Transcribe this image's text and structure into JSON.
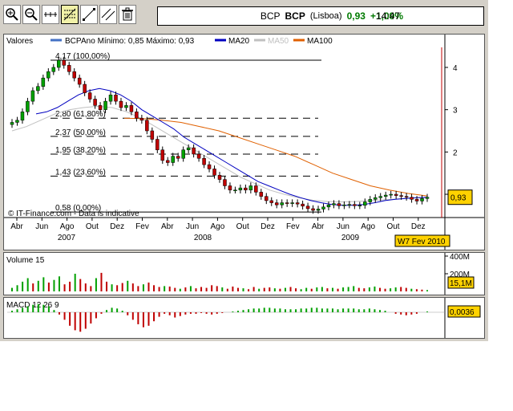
{
  "toolbar": {
    "buttons": [
      {
        "icon": "zoom-in-icon"
      },
      {
        "icon": "zoom-out-icon"
      },
      {
        "icon": "crosshair-icon"
      },
      {
        "icon": "fibonacci-icon"
      },
      {
        "icon": "trend-line-icon"
      },
      {
        "icon": "channel-icon"
      },
      {
        "icon": "trash-icon"
      }
    ]
  },
  "quote": {
    "ticker1": "BCP",
    "ticker2": "BCP",
    "exchange": "(Lisboa)",
    "price": "0,93",
    "change": "+1,09%",
    "time": "14:47"
  },
  "colors": {
    "up": "#00a000",
    "down": "#c00000",
    "ma20": "#0000c0",
    "ma50": "#c0c0c0",
    "ma100": "#e06000",
    "volume_up": "#00a000",
    "volume_down": "#c00000",
    "macd_pos": "#00a000",
    "macd_neg": "#c00000"
  },
  "legend": {
    "valores": "Valores",
    "bcp": "BCP",
    "minmax": "Ano Mínimo: 0,85 Máximo: 0,93",
    "ma20": "MA20",
    "ma50": "MA50",
    "ma100": "MA100"
  },
  "chart_data": [
    {
      "type": "candlestick",
      "title": "",
      "xlabel": "",
      "ylabel": "",
      "x_tick_labels": [
        "Abr",
        "Jun",
        "Ago",
        "Out",
        "Dez",
        "Fev",
        "Abr",
        "Jun",
        "Ago",
        "Out",
        "Dez",
        "Fev",
        "Abr",
        "Jun",
        "Ago",
        "Out",
        "Dez"
      ],
      "year_labels": [
        "2007",
        "2008",
        "2009"
      ],
      "y_tick_labels": [
        "1",
        "2",
        "3",
        "4"
      ],
      "ylim": [
        0.45,
        4.55
      ],
      "fibonacci_levels": [
        {
          "value": 4.17,
          "label": "4,17 (100,00%)"
        },
        {
          "value": 2.8,
          "label": "2,80 (61,80%)"
        },
        {
          "value": 2.37,
          "label": "2,37 (50,00%)"
        },
        {
          "value": 1.95,
          "label": "1,95 (38,20%)"
        },
        {
          "value": 1.43,
          "label": "1,43 (23,60%)"
        },
        {
          "value": 0.58,
          "label": "0,58 (0,00%)"
        }
      ],
      "close_series": [
        2.7,
        2.75,
        2.95,
        3.2,
        3.45,
        3.55,
        3.75,
        3.9,
        4.0,
        4.17,
        4.05,
        3.9,
        3.75,
        3.6,
        3.4,
        3.25,
        3.1,
        3.0,
        3.2,
        3.35,
        3.2,
        3.05,
        3.1,
        2.95,
        2.8,
        2.75,
        2.5,
        2.3,
        2.05,
        1.8,
        1.75,
        1.9,
        1.85,
        2.05,
        2.1,
        1.95,
        1.85,
        1.7,
        1.6,
        1.45,
        1.35,
        1.2,
        1.1,
        1.1,
        1.15,
        1.1,
        1.2,
        1.05,
        0.95,
        0.85,
        0.8,
        0.75,
        0.8,
        0.78,
        0.8,
        0.77,
        0.72,
        0.66,
        0.62,
        0.65,
        0.7,
        0.75,
        0.78,
        0.73,
        0.75,
        0.76,
        0.73,
        0.74,
        0.82,
        0.88,
        0.92,
        0.95,
        0.98,
        1.0,
        0.97,
        0.95,
        0.93,
        0.88,
        0.84,
        0.9,
        0.93
      ],
      "ma20": [
        2.9,
        2.95,
        3.05,
        3.2,
        3.35,
        3.45,
        3.5,
        3.45,
        3.35,
        3.2,
        3.0,
        2.85,
        2.7,
        2.55,
        2.35,
        2.2,
        2.05,
        1.9,
        1.75,
        1.6,
        1.45,
        1.3,
        1.2,
        1.1,
        1.0,
        0.92,
        0.85,
        0.8,
        0.76,
        0.74,
        0.74,
        0.76,
        0.8,
        0.85,
        0.88,
        0.9,
        0.92,
        0.93
      ],
      "ma50": [
        2.5,
        2.6,
        2.75,
        2.9,
        3.0,
        3.05,
        3.08,
        3.05,
        2.95,
        2.8,
        2.6,
        2.4,
        2.2,
        2.0,
        1.8,
        1.6,
        1.4,
        1.25,
        1.1,
        1.0,
        0.92,
        0.86,
        0.83,
        0.82,
        0.83,
        0.85,
        0.87,
        0.89,
        0.91,
        0.92
      ],
      "ma100": [
        2.8,
        2.79,
        2.75,
        2.7,
        2.6,
        2.5,
        2.35,
        2.2,
        2.05,
        1.9,
        1.7,
        1.5,
        1.35,
        1.2,
        1.1,
        1.02,
        0.96
      ],
      "credit": "© IT-Finance.com - Data is indicative",
      "last_price_label": "0,93",
      "date_marker": "W7 Fev 2010"
    },
    {
      "type": "bar",
      "title": "Volume 15",
      "y_tick_labels": [
        "400M",
        "200M"
      ],
      "ylim": [
        0,
        400
      ],
      "last_value_label": "15,1M",
      "values": [
        40,
        70,
        110,
        150,
        90,
        120,
        160,
        100,
        130,
        170,
        80,
        110,
        200,
        140,
        90,
        60,
        150,
        210,
        110,
        80,
        70,
        95,
        120,
        90,
        60,
        80,
        100,
        70,
        50,
        60,
        55,
        40,
        30,
        45,
        60,
        35,
        50,
        40,
        70,
        60,
        45,
        30,
        55,
        40,
        35,
        25,
        50,
        30,
        40,
        45,
        35,
        30,
        40,
        50,
        35,
        25,
        40,
        30,
        45,
        50,
        35,
        40,
        30,
        45,
        50,
        60,
        40,
        35,
        45,
        55,
        40,
        30,
        35,
        45,
        50,
        40,
        30,
        25,
        20,
        15
      ],
      "up": [
        1,
        1,
        1,
        1,
        0,
        1,
        1,
        0,
        1,
        1,
        0,
        0,
        1,
        0,
        0,
        0,
        1,
        0,
        0,
        1,
        0,
        0,
        1,
        0,
        0,
        1,
        0,
        0,
        0,
        1,
        0,
        0,
        1,
        0,
        1,
        0,
        0,
        0,
        0,
        0,
        1,
        0,
        0,
        0,
        1,
        0,
        0,
        1,
        0,
        0,
        1,
        0,
        1,
        0,
        0,
        1,
        1,
        0,
        1,
        1,
        0,
        1,
        0,
        1,
        1,
        1,
        0,
        0,
        1,
        1,
        0,
        0,
        1,
        1,
        0,
        0,
        1,
        0,
        0,
        1
      ]
    },
    {
      "type": "bar",
      "title": "MACD 12 26 9",
      "last_value_label": "0,0036",
      "ylim": [
        -0.3,
        0.15
      ],
      "values": [
        0.02,
        0.04,
        0.06,
        0.08,
        0.1,
        0.11,
        0.1,
        0.08,
        0.03,
        -0.03,
        -0.1,
        -0.18,
        -0.24,
        -0.26,
        -0.22,
        -0.15,
        -0.08,
        -0.02,
        0.03,
        0.06,
        0.05,
        0.02,
        -0.04,
        -0.1,
        -0.16,
        -0.2,
        -0.18,
        -0.12,
        -0.06,
        -0.02,
        -0.04,
        -0.07,
        -0.05,
        -0.03,
        -0.02,
        -0.02,
        -0.01,
        -0.02,
        -0.03,
        -0.02,
        -0.01,
        0.0,
        0.01,
        0.02,
        0.03,
        0.04,
        0.05,
        0.05,
        0.06,
        0.06,
        0.05,
        0.05,
        0.04,
        0.04,
        0.04,
        0.05,
        0.05,
        0.06,
        0.06,
        0.05,
        0.05,
        0.05,
        0.04,
        0.05,
        0.05,
        0.05,
        0.04,
        0.04,
        0.05,
        0.04,
        0.03,
        0.02,
        0.0,
        -0.02,
        -0.03,
        -0.04,
        -0.03,
        -0.02,
        0.0,
        0.01
      ]
    }
  ]
}
